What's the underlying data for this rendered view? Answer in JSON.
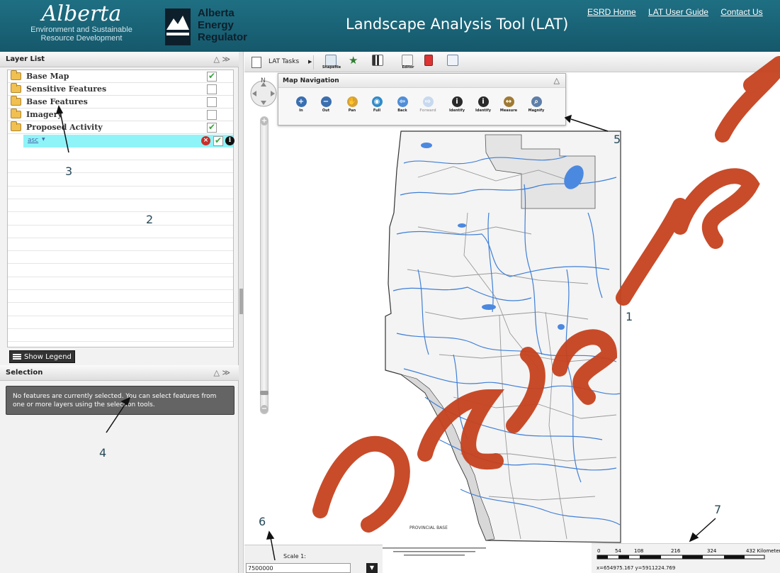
{
  "header": {
    "alberta_wordmark": "Alberta",
    "alberta_sub1": "Environment and Sustainable",
    "alberta_sub2": "Resource Development",
    "aer_line1": "Alberta",
    "aer_line2": "Energy",
    "aer_line3": "Regulator",
    "title": "Landscape Analysis Tool (LAT)",
    "links": [
      "ESRD Home",
      "LAT User Guide",
      "Contact Us"
    ]
  },
  "layer_list": {
    "title": "Layer List",
    "layers": [
      {
        "label": "Base Map",
        "checked": true
      },
      {
        "label": "Sensitive Features",
        "checked": false
      },
      {
        "label": "Base Features",
        "checked": false
      },
      {
        "label": "Imagery",
        "checked": false
      },
      {
        "label": "Proposed Activity",
        "checked": true
      }
    ],
    "sublayer": {
      "label": "asc",
      "checked": true
    },
    "show_legend": "Show Legend"
  },
  "selection": {
    "title": "Selection",
    "message": "No features are currently selected. You can select features from one or more layers using the selection tools."
  },
  "toolbar": {
    "lat_tasks": "LAT Tasks",
    "buttons": [
      {
        "caption": "Shapefile",
        "icon": "shapefile-icon"
      },
      {
        "caption": "",
        "icon": "favorite-edit-icon"
      },
      {
        "caption": "",
        "icon": "chart-edit-icon"
      },
      {
        "caption": "Editor",
        "icon": "editor-icon"
      },
      {
        "caption": "",
        "icon": "pdf-icon"
      },
      {
        "caption": "",
        "icon": "export-icon"
      }
    ]
  },
  "map_navigation": {
    "title": "Map Navigation",
    "tools": [
      {
        "caption": "In",
        "icon": "zoom-in-icon"
      },
      {
        "caption": "Out",
        "icon": "zoom-out-icon"
      },
      {
        "caption": "Pan",
        "icon": "pan-hand-icon"
      },
      {
        "caption": "Full",
        "icon": "full-extent-icon"
      },
      {
        "caption": "Back",
        "icon": "back-arrow-icon"
      },
      {
        "caption": "Forward",
        "icon": "forward-arrow-icon"
      },
      {
        "caption": "Identify",
        "icon": "identify-icon"
      },
      {
        "caption": "Identify",
        "icon": "identify-multi-icon"
      },
      {
        "caption": "Measure",
        "icon": "measure-icon"
      },
      {
        "caption": "Magnify",
        "icon": "magnify-icon"
      }
    ]
  },
  "map": {
    "north_label": "N",
    "base_label": "PROVINCIAL BASE"
  },
  "scale": {
    "label": "Scale 1:",
    "value": "7500000"
  },
  "scalebar": {
    "ticks": [
      "0",
      "54",
      "108",
      "216",
      "324",
      "432 Kilometers"
    ]
  },
  "coords": "x=654975.167 y=5911224.769",
  "annotations": [
    "1",
    "2",
    "3",
    "4",
    "5",
    "6",
    "7"
  ],
  "colors": {
    "header": "#1a6679",
    "river": "#3f7fd6",
    "road": "#999999",
    "watermark": "#c6421f",
    "selected_row": "#8ff4f8"
  }
}
